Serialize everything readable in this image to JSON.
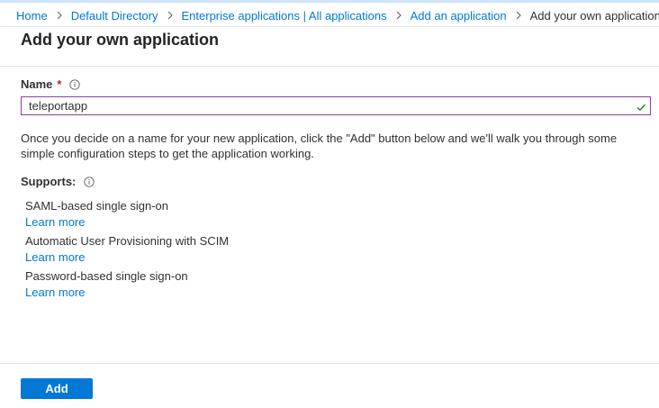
{
  "breadcrumb": {
    "items": [
      "Home",
      "Default Directory",
      "Enterprise applications | All applications",
      "Add an application"
    ],
    "current": "Add your own application"
  },
  "page": {
    "title": "Add your own application"
  },
  "name_field": {
    "label": "Name",
    "required_marker": "*",
    "value": "teleportapp",
    "valid": true
  },
  "description": "Once you decide on a name for your new application, click the \"Add\" button below and we'll walk you through some simple configuration steps to get the application working.",
  "supports": {
    "label": "Supports:",
    "items": [
      {
        "title": "SAML-based single sign-on",
        "link": "Learn more"
      },
      {
        "title": "Automatic User Provisioning with SCIM",
        "link": "Learn more"
      },
      {
        "title": "Password-based single sign-on",
        "link": "Learn more"
      }
    ]
  },
  "actions": {
    "add_label": "Add"
  },
  "colors": {
    "link": "#0078d4",
    "primary_button": "#0078d4",
    "input_border_focus": "#8a3f9e",
    "valid_check": "#107c10",
    "required": "#a4262c"
  },
  "icons": {
    "breadcrumb_separator": "chevron-right-icon",
    "info": "info-icon",
    "valid": "checkmark-icon"
  }
}
